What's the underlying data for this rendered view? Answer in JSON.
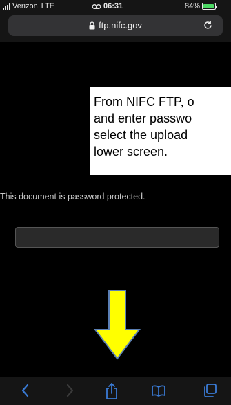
{
  "status_bar": {
    "carrier": "Verizon",
    "network": "LTE",
    "time": "06:31",
    "battery": "84%",
    "battery_level": 0.84
  },
  "browser": {
    "url": "ftp.nifc.gov",
    "icons": {
      "lock": "lock-icon",
      "reload": "reload-icon",
      "back": "back-icon",
      "forward": "forward-icon",
      "share": "share-icon",
      "bookmarks": "bookmarks-icon",
      "tabs": "tabs-icon"
    }
  },
  "callout": {
    "lines": [
      "From NIFC FTP, o",
      "and enter passwo",
      "select the upload",
      "lower screen."
    ]
  },
  "document": {
    "message": "This document is password protected.",
    "password_value": ""
  },
  "colors": {
    "toolbar_icon": "#3a7bd5",
    "arrow_fill": "#ffff00",
    "arrow_stroke": "#5b7fb4"
  }
}
